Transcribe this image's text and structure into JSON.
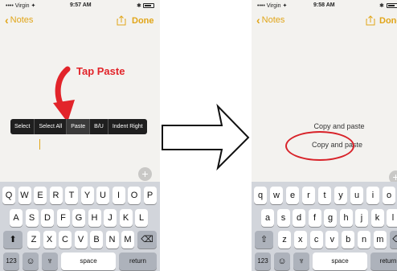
{
  "left_screen": {
    "status": {
      "carrier": "•••• Virgin ✦",
      "time": "9:57 AM",
      "bluetooth": "✱"
    },
    "nav": {
      "back_label": "Notes",
      "done_label": "Done"
    },
    "annotation": "Tap Paste",
    "callout_menu": [
      "Select",
      "Select All",
      "Paste",
      "B/U",
      "Indent Right"
    ],
    "active_menu_item": "Paste",
    "keyboard": {
      "row1": [
        "Q",
        "W",
        "E",
        "R",
        "T",
        "Y",
        "U",
        "I",
        "O",
        "P"
      ],
      "row2": [
        "A",
        "S",
        "D",
        "F",
        "G",
        "H",
        "J",
        "K",
        "L"
      ],
      "row3": [
        "Z",
        "X",
        "C",
        "V",
        "B",
        "N",
        "M"
      ],
      "numbers_label": "123",
      "space_label": "space",
      "return_label": "return"
    }
  },
  "right_screen": {
    "status": {
      "carrier": "•••• Virgin ✦",
      "time": "9:58 AM",
      "bluetooth": "✱"
    },
    "nav": {
      "back_label": "Notes",
      "done_label": "Done"
    },
    "note_lines": [
      "Copy and paste",
      "Copy and paste"
    ],
    "keyboard": {
      "row1": [
        "q",
        "w",
        "e",
        "r",
        "t",
        "y",
        "u",
        "i",
        "o",
        "p"
      ],
      "row2": [
        "a",
        "s",
        "d",
        "f",
        "g",
        "h",
        "j",
        "k",
        "l"
      ],
      "row3": [
        "z",
        "x",
        "c",
        "v",
        "b",
        "n",
        "m"
      ],
      "numbers_label": "123",
      "space_label": "space",
      "return_label": "return"
    }
  },
  "colors": {
    "accent": "#e1a518",
    "annotation": "#e2242a",
    "keyboard_bg": "#d2d5db",
    "menu_bg": "#1f1f1f"
  }
}
